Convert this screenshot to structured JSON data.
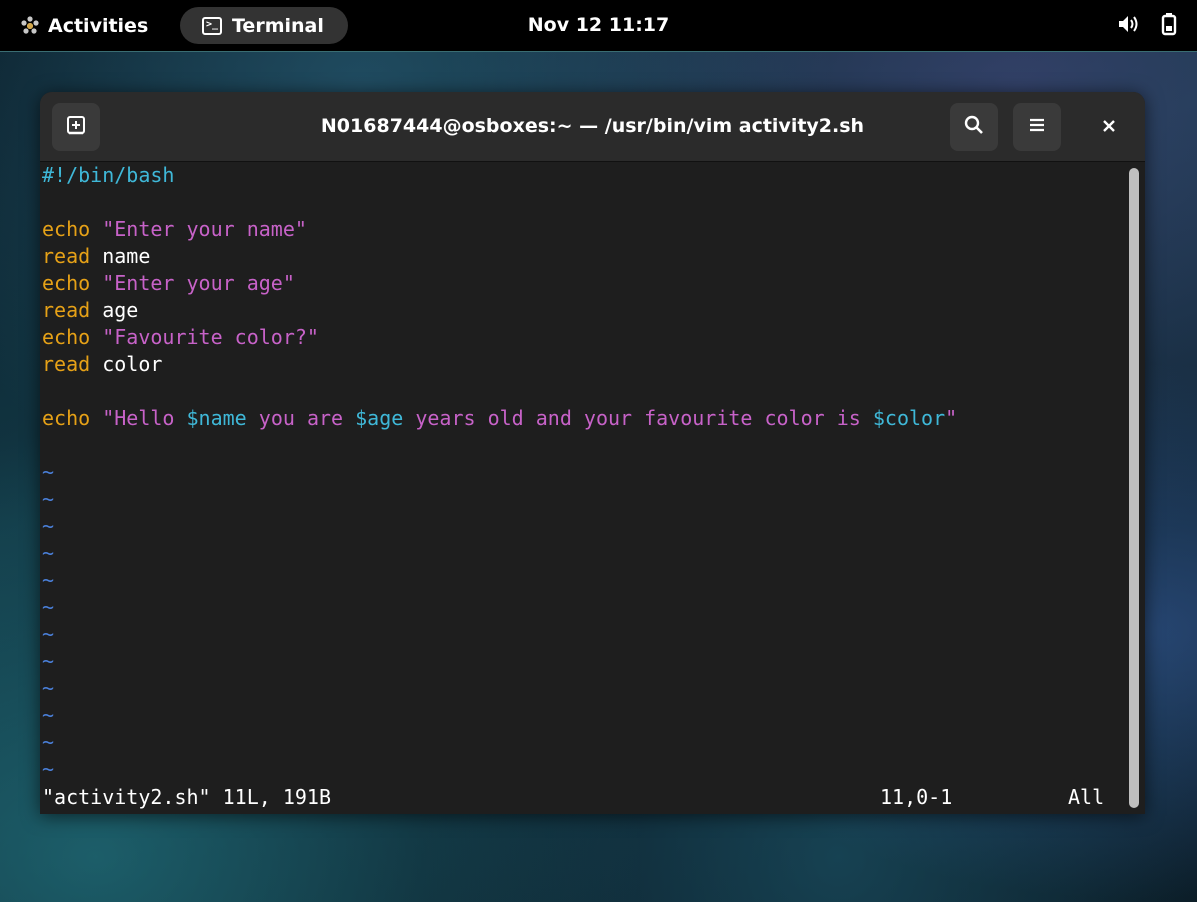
{
  "topbar": {
    "activities_label": "Activities",
    "app_name": "Terminal",
    "datetime": "Nov 12  11:17",
    "icons": [
      "gnome-logo-icon",
      "terminal-icon",
      "volume-icon",
      "battery-icon"
    ]
  },
  "window": {
    "title": "N01687444@osboxes:~ — /usr/bin/vim activity2.sh",
    "buttons": [
      "new-tab-icon",
      "search-icon",
      "menu-icon",
      "close-icon"
    ]
  },
  "editor": {
    "shebang": "#!/bin/bash",
    "lines": [
      {
        "kw": "echo",
        "str": "\"Enter your name\""
      },
      {
        "kw": "read",
        "arg": "name"
      },
      {
        "kw": "echo",
        "str": "\"Enter your age\""
      },
      {
        "kw": "read",
        "arg": "age"
      },
      {
        "kw": "echo",
        "str": "\"Favourite color?\""
      },
      {
        "kw": "read",
        "arg": "color"
      }
    ],
    "final_echo": {
      "kw": "echo",
      "q1": "\"Hello ",
      "v1": "$name",
      "s2": " you are ",
      "v2": "$age",
      "s3": " years old and your favourite color is ",
      "v3": "$color",
      "q2": "\""
    },
    "tilde": "~",
    "empty_line_count": 12,
    "status_file": "\"activity2.sh\" 11L, 191B",
    "status_pos": "11,0-1",
    "status_view": "All"
  },
  "colors": {
    "keyword": "#e6a117",
    "string": "#c762c8",
    "variable": "#3fb8d8",
    "tilde": "#4a7fd8",
    "background": "#1e1e1e"
  }
}
